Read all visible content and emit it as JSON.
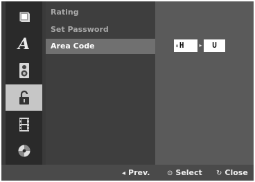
{
  "sidebar": {
    "icons": [
      {
        "name": "picture-icon",
        "selected": false
      },
      {
        "name": "language-icon",
        "label": "A",
        "selected": false
      },
      {
        "name": "speaker-icon",
        "selected": false
      },
      {
        "name": "lock-icon",
        "selected": true
      },
      {
        "name": "film-icon",
        "selected": false
      },
      {
        "name": "disc-icon",
        "selected": false
      }
    ]
  },
  "menu": {
    "items": [
      {
        "label": "Rating",
        "active": false
      },
      {
        "label": "Set Password",
        "active": false
      },
      {
        "label": "Area Code",
        "active": true
      }
    ]
  },
  "area_code": {
    "first_char": "H",
    "second_char": "U",
    "updown_glyph": "⬍",
    "next_glyph": "▸"
  },
  "footer": {
    "prev_glyph": "◂",
    "prev_label": "Prev.",
    "select_glyph": "⊙",
    "select_label": "Select",
    "close_glyph": "↻",
    "close_label": "Close"
  },
  "colors": {
    "icon_column_bg": "#2a2a2a",
    "menu_bg": "#3e3e3e",
    "menu_active_bg": "#707070",
    "value_panel_bg": "#5a5a5a",
    "selected_icon_bg": "#c6c6c6",
    "footer_bg": "#4a4a4a"
  }
}
